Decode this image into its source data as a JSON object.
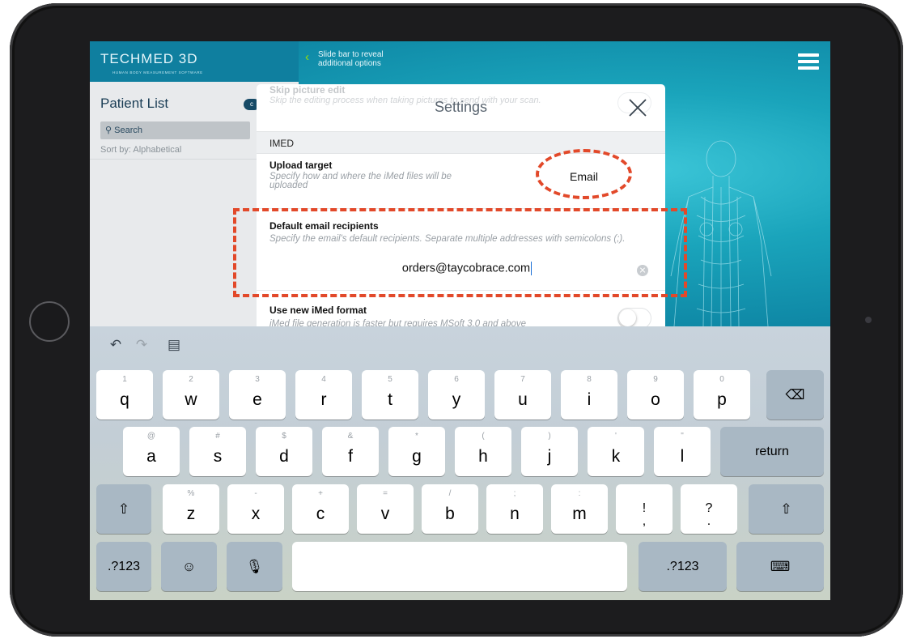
{
  "app": {
    "logo": "TECHMED 3D",
    "logo_subtitle": "HUMAN BODY MEASUREMENT SOFTWARE",
    "slide_hint_line1": "Slide bar to reveal",
    "slide_hint_line2": "additional options"
  },
  "patient_list": {
    "title": "Patient List",
    "search_placeholder": "Search",
    "sort_label": "Sort by: Alphabetical"
  },
  "settings": {
    "title": "Settings",
    "ghost_row_title": "Skip picture edit",
    "ghost_row_desc": "Skip the editing process when taking pictures to send with your scan.",
    "section_label": "IMED",
    "upload_target": {
      "title": "Upload target",
      "description": "Specify how and where the iMed files will be uploaded",
      "value": "Email"
    },
    "default_recipients": {
      "title": "Default email recipients",
      "description": "Specify the email's default recipients. Separate multiple addresses with semicolons (;).",
      "value": "orders@taycobrace.com"
    },
    "new_format": {
      "title": "Use new iMed format",
      "description": "iMed file generation is faster but requires MSoft 3.0 and above",
      "enabled": false
    }
  },
  "annotation_color": "#e2492a",
  "keyboard": {
    "row1": [
      {
        "main": "q",
        "alt": "1"
      },
      {
        "main": "w",
        "alt": "2"
      },
      {
        "main": "e",
        "alt": "3"
      },
      {
        "main": "r",
        "alt": "4"
      },
      {
        "main": "t",
        "alt": "5"
      },
      {
        "main": "y",
        "alt": "6"
      },
      {
        "main": "u",
        "alt": "7"
      },
      {
        "main": "i",
        "alt": "8"
      },
      {
        "main": "o",
        "alt": "9"
      },
      {
        "main": "p",
        "alt": "0"
      }
    ],
    "row2": [
      {
        "main": "a",
        "alt": "@"
      },
      {
        "main": "s",
        "alt": "#"
      },
      {
        "main": "d",
        "alt": "$"
      },
      {
        "main": "f",
        "alt": "&"
      },
      {
        "main": "g",
        "alt": "*"
      },
      {
        "main": "h",
        "alt": "("
      },
      {
        "main": "j",
        "alt": ")"
      },
      {
        "main": "k",
        "alt": "'"
      },
      {
        "main": "l",
        "alt": "\""
      }
    ],
    "row3": [
      {
        "main": "z",
        "alt": "%"
      },
      {
        "main": "x",
        "alt": "-"
      },
      {
        "main": "c",
        "alt": "+"
      },
      {
        "main": "v",
        "alt": "="
      },
      {
        "main": "b",
        "alt": "/"
      },
      {
        "main": "n",
        "alt": ";"
      },
      {
        "main": "m",
        "alt": ":"
      },
      {
        "main": "!",
        "alt": ""
      },
      {
        "main": "?",
        "alt": ""
      }
    ],
    "row3_sub": [
      "",
      "",
      "",
      "",
      "",
      "",
      "",
      ",",
      "."
    ],
    "return_label": "return",
    "numbers_label": ".?123",
    "icons": [
      "undo-icon",
      "redo-icon",
      "paste-icon",
      "backspace-icon",
      "shift-icon",
      "emoji-icon",
      "microphone-icon",
      "keyboard-dismiss-icon"
    ]
  }
}
